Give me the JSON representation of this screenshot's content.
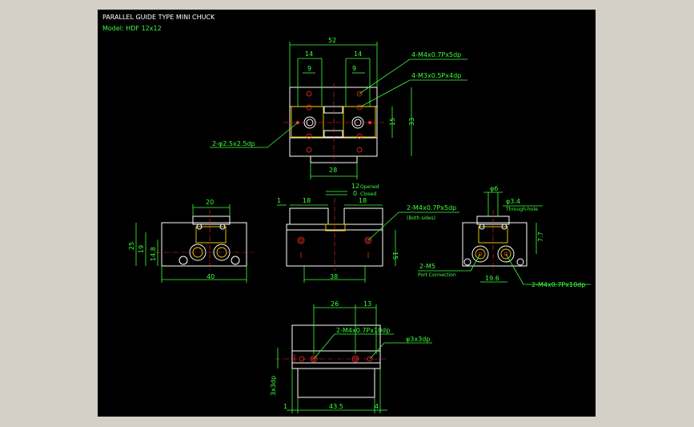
{
  "title": "PARALLEL GUIDE TYPE MINI CHUCK",
  "model": "Model: HDF 12x12",
  "top_view": {
    "dim_width": "52",
    "dim_left_14": "14",
    "dim_right_14": "14",
    "dim_left_9": "9",
    "dim_right_9": "9",
    "dim_15": "15",
    "dim_33": "33",
    "dim_28": "28",
    "label_m4": "4-M4x0.7Px5dp",
    "label_m3": "4-M3x0.5Px4dp",
    "label_pin": "2-φ2.5x2.5dp"
  },
  "front_view": {
    "dim_1": "1",
    "dim_18a": "18",
    "dim_18b": "18",
    "dim_12": "12",
    "dim_0": "0",
    "opened": "Opened",
    "closed": "Closed",
    "label_m4": "2-M4x0.7Px5dp",
    "label_both": "(Both sides)",
    "dim_15": "15",
    "dim_38": "38"
  },
  "left_view": {
    "dim_20": "20",
    "dim_25": "25",
    "dim_19": "19",
    "dim_14_8": "14.8",
    "dim_40": "40"
  },
  "right_view": {
    "dim_6": "φ6",
    "dim_3_4": "φ3.4",
    "through_hole": "Through-hole",
    "dim_7_7": "7.7",
    "label_m5": "2-M5",
    "port_conn": "Port Connection",
    "dim_19_6": "19.6",
    "label_m4": "2-M4x0.7Px10dp"
  },
  "bottom_view": {
    "dim_26": "26",
    "dim_13": "13",
    "label_m4": "2-M4x0.7Px10dp",
    "label_pin": "φ3x3dp",
    "dim_3x3": "3x3dp",
    "dim_1": "1",
    "dim_43_5": "43.5",
    "dim_4": "4"
  }
}
